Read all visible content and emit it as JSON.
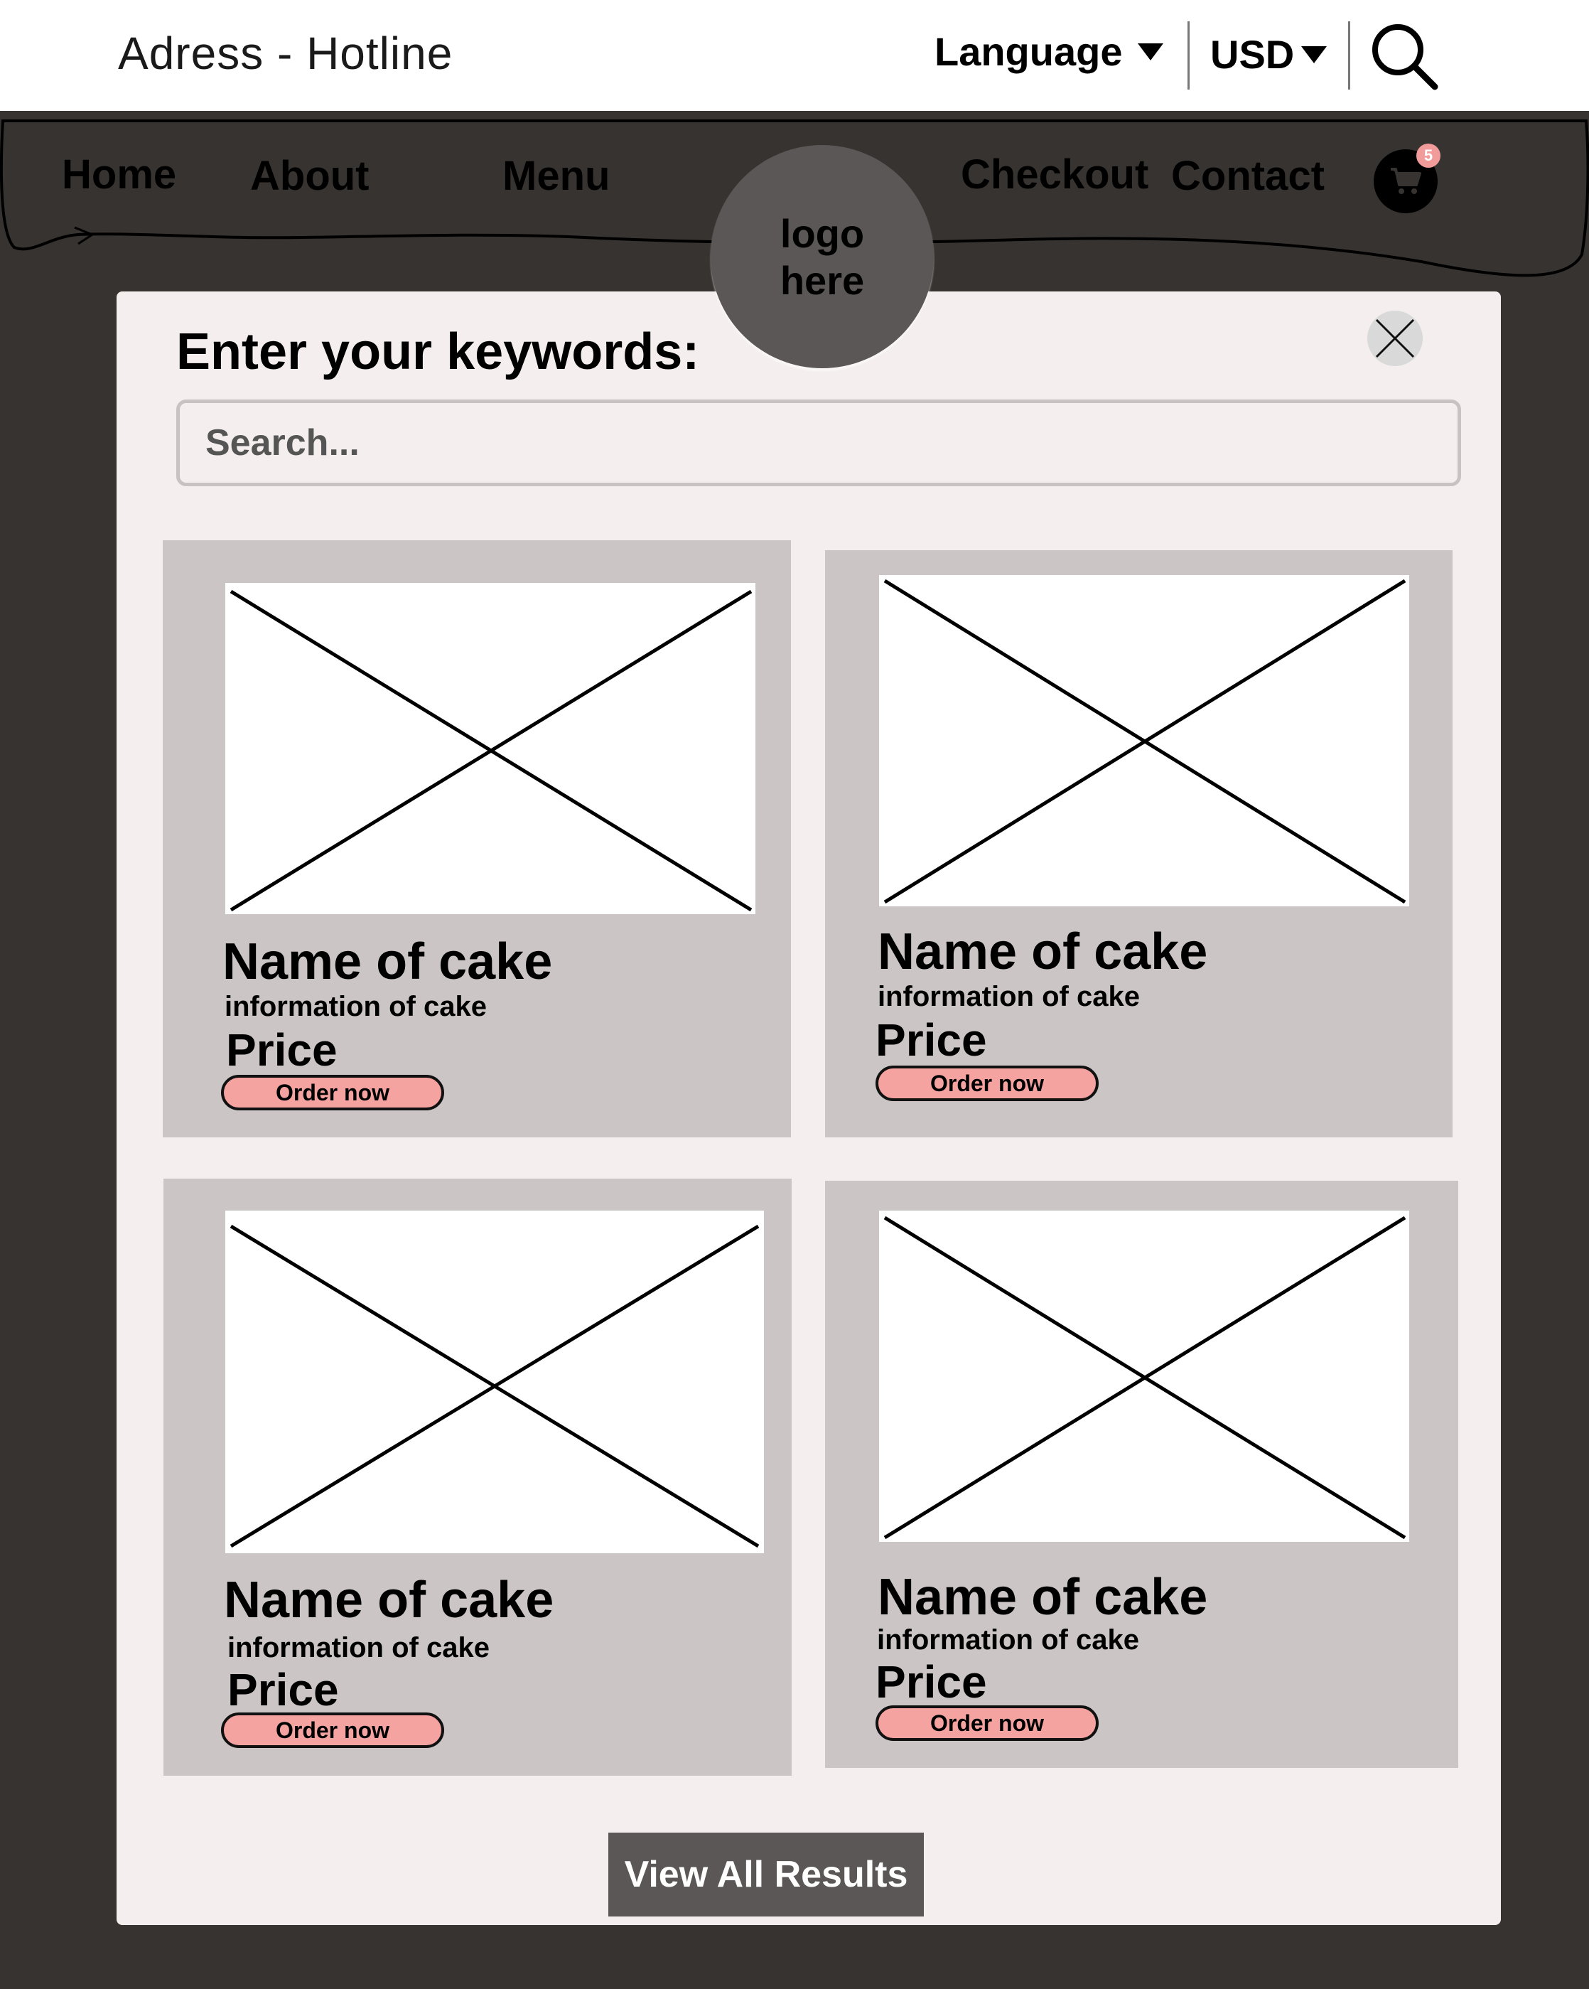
{
  "header": {
    "address_hotline": "Adress - Hotline",
    "language_label": "Language",
    "currency_label": "USD"
  },
  "nav": {
    "items": [
      "Home",
      "About",
      "Menu",
      "Checkout",
      "Contact"
    ],
    "logo_line1": "logo",
    "logo_line2": "here",
    "cart_count": "5"
  },
  "search_modal": {
    "title": "Enter your keywords:",
    "placeholder": "Search...",
    "results": [
      {
        "name": "Name of cake",
        "info": "information of cake",
        "price": "Price",
        "button": "Order now"
      },
      {
        "name": "Name of cake",
        "info": "information of cake",
        "price": "Price",
        "button": "Order now"
      },
      {
        "name": "Name of cake",
        "info": "information of cake",
        "price": "Price",
        "button": "Order now"
      },
      {
        "name": "Name of cake",
        "info": "information of cake",
        "price": "Price",
        "button": "Order now"
      }
    ],
    "view_all_label": "View All Results"
  },
  "colors": {
    "background": "#373330",
    "modal_bg": "#f4efee",
    "card_bg": "#cbc5c5",
    "order_button": "#f4a3a1",
    "view_all_button": "#5a5756",
    "cart_badge": "#f29b9b"
  }
}
